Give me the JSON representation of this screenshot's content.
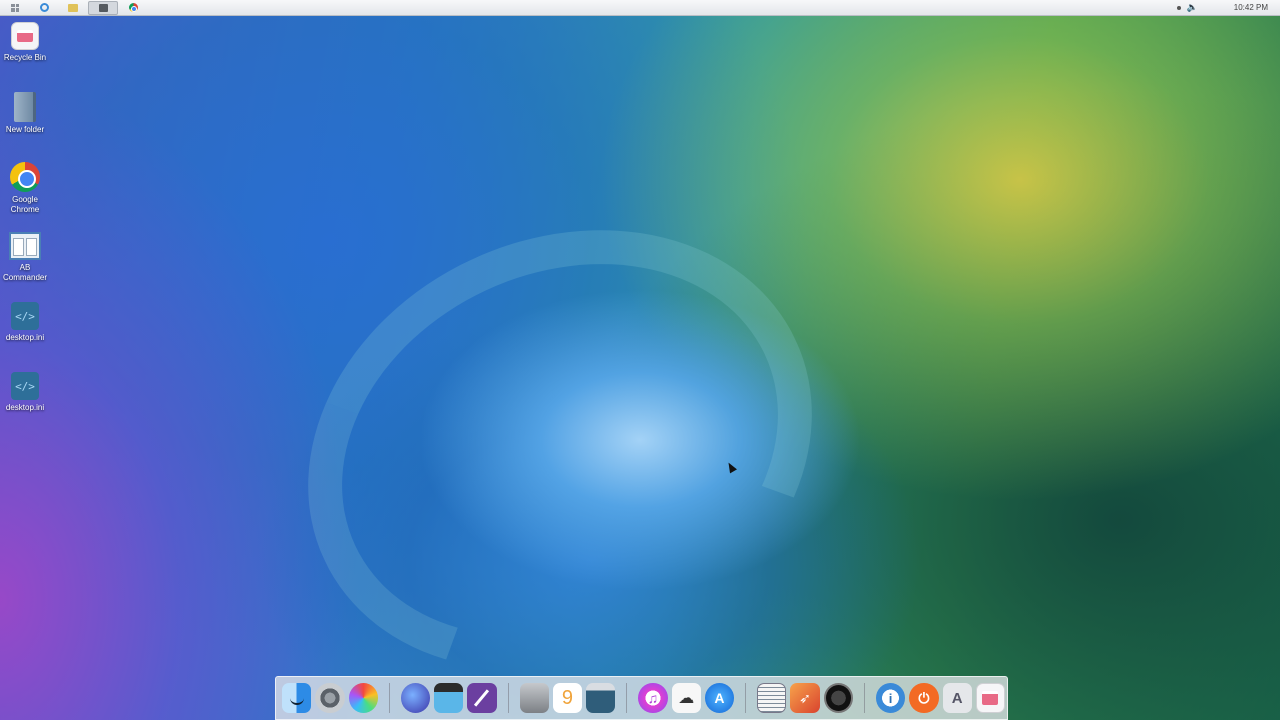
{
  "taskbar": {
    "buttons": [
      {
        "icon": "start-grid-icon"
      },
      {
        "icon": "internet-explorer-icon"
      },
      {
        "icon": "file-explorer-icon"
      },
      {
        "icon": "monitor-icon"
      },
      {
        "icon": "chrome-icon"
      }
    ],
    "tray": {
      "clock": "10:42 PM",
      "icons": [
        "notification-dot-icon",
        "volume-icon"
      ]
    }
  },
  "desktop": {
    "icons": [
      {
        "label": "Recycle Bin",
        "icon": "recycle-bin-icon"
      },
      {
        "label": "New folder",
        "icon": "folder-icon"
      },
      {
        "label": "Google\nChrome",
        "icon": "chrome-icon"
      },
      {
        "label": "AB\nCommander",
        "icon": "ab-commander-icon"
      },
      {
        "label": "desktop.ini",
        "icon": "code-file-icon"
      },
      {
        "label": "desktop.ini",
        "icon": "code-file-icon"
      }
    ],
    "ini_glyph": "</>"
  },
  "dock": {
    "groups": [
      [
        "finder-icon",
        "system-preferences-icon",
        "color-picker-icon"
      ],
      [
        "globe-icon",
        "video-clapper-icon",
        "pen-editor-icon"
      ],
      [
        "hard-drive-icon",
        "ios9-icon",
        "preview-icon"
      ],
      [
        "itunes-icon",
        "icloud-icon",
        "app-store-icon"
      ],
      [
        "notes-icon",
        "rocket-launcher-icon",
        "dashboard-gauge-icon"
      ],
      [
        "info-icon",
        "power-icon",
        "applications-folder-icon",
        "trash-icon"
      ]
    ],
    "glyphs": {
      "ios9": "9",
      "itunes": "♫",
      "icloud": "☁",
      "appstore": "A",
      "rocket": "➶",
      "info": "i",
      "power": "⏻",
      "apps": "A"
    }
  },
  "colors": {
    "dock_background": "#e1e4e8",
    "taskbar_background": "#eef0f3",
    "label_text": "#ffffff"
  }
}
